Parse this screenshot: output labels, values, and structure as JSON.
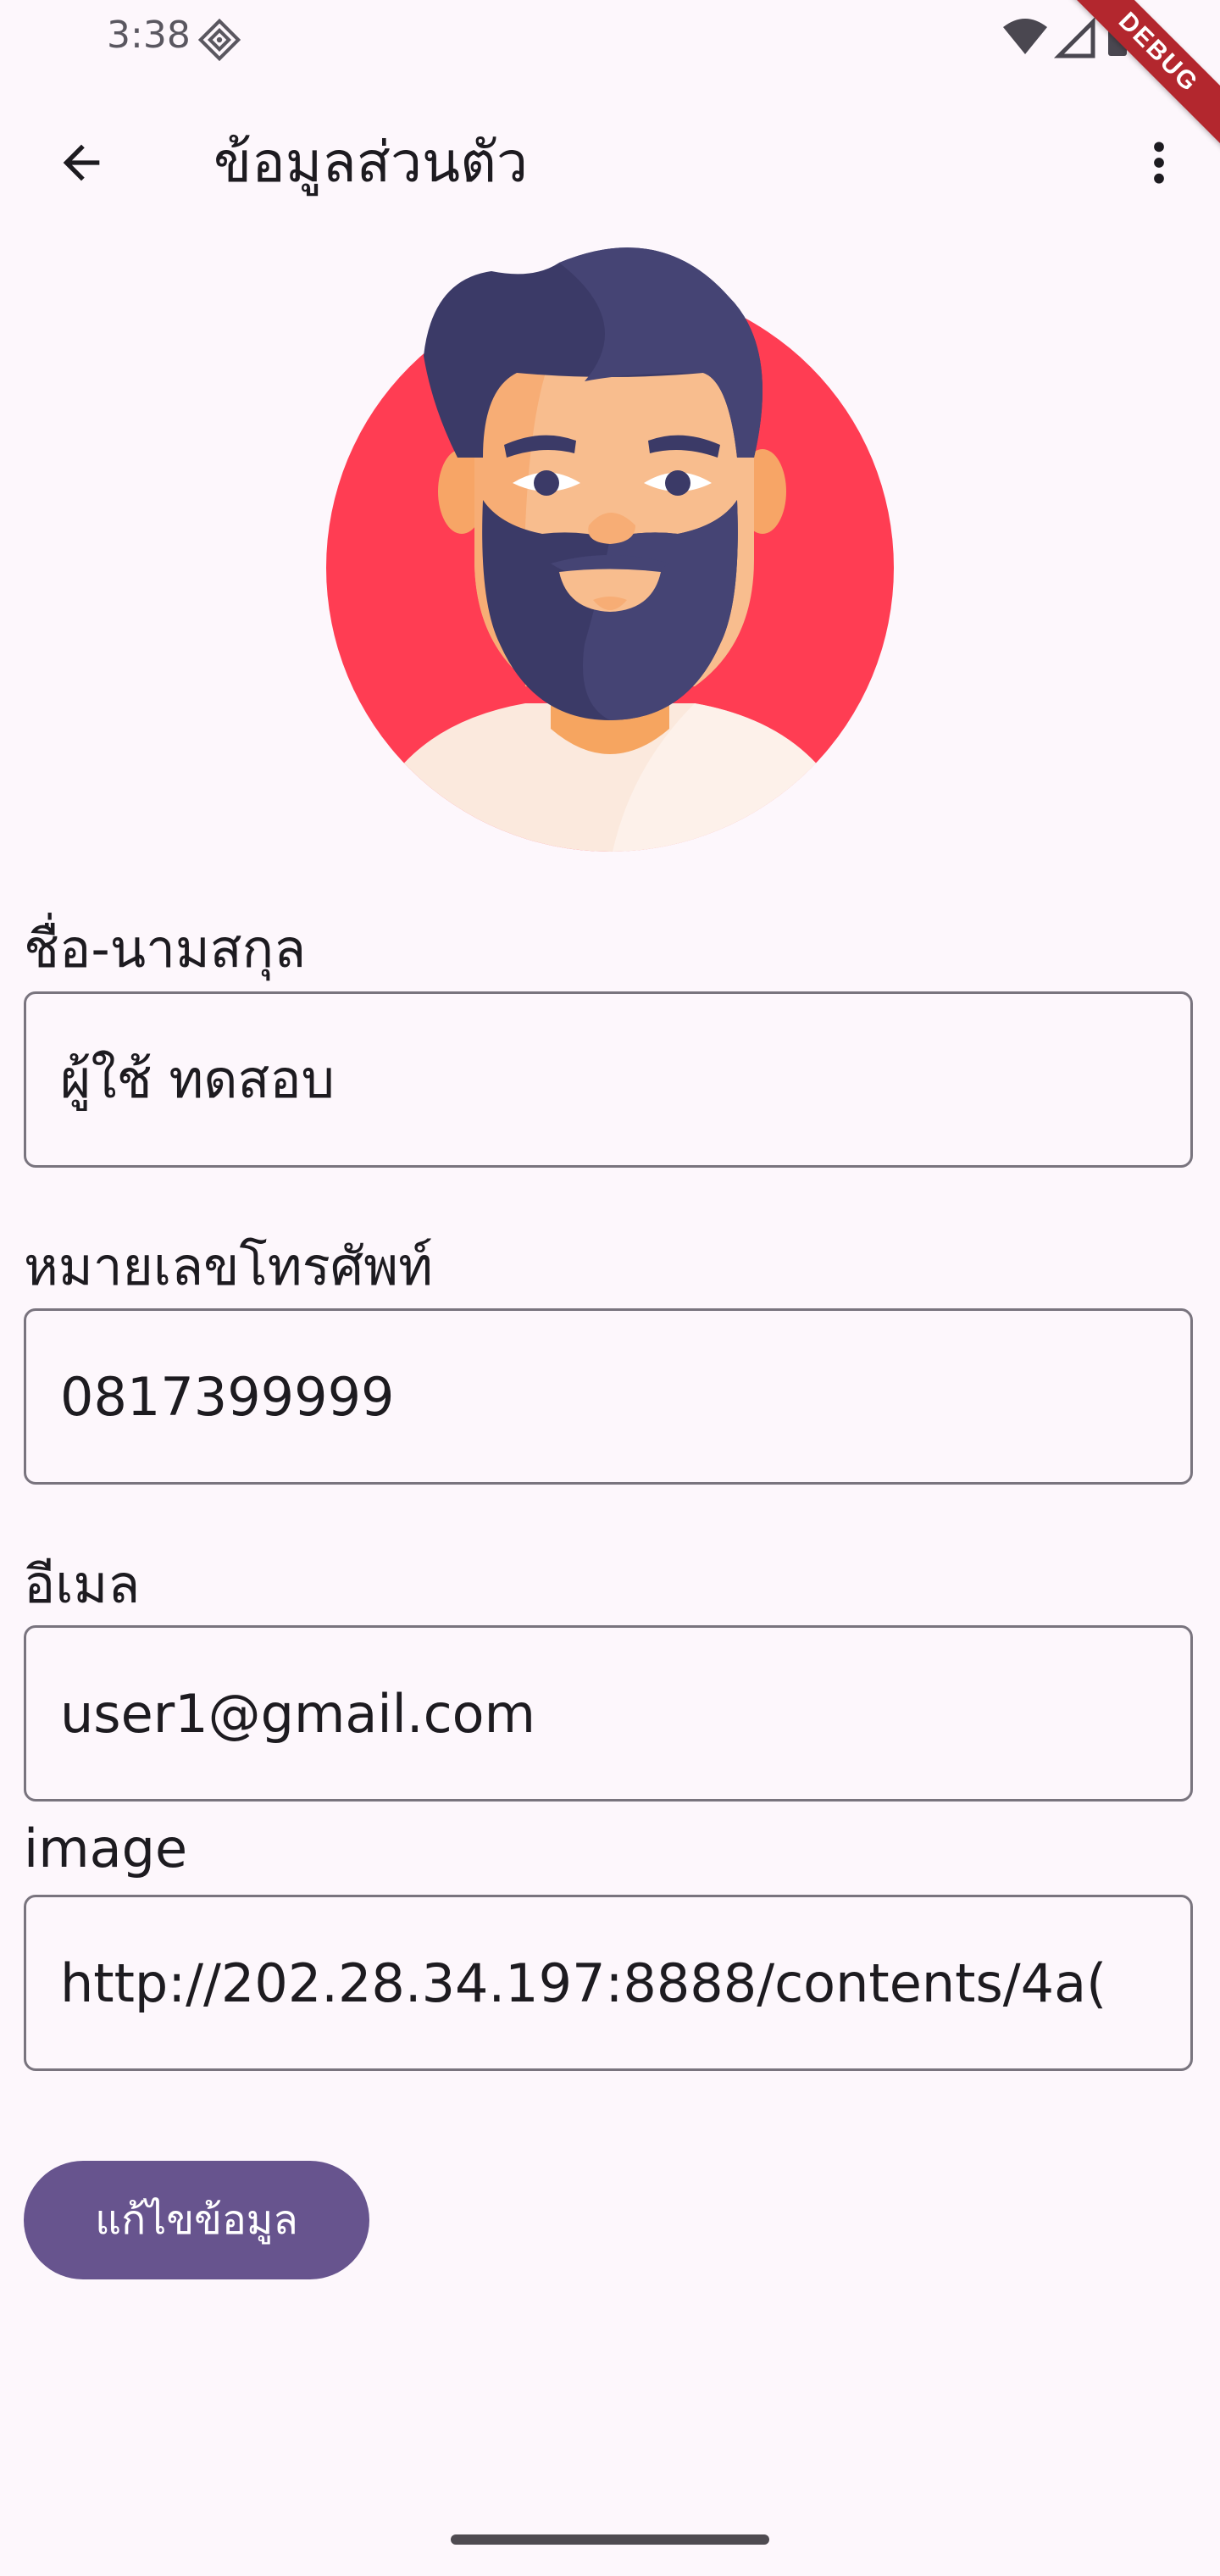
{
  "status_bar": {
    "time": "3:38",
    "app_icon": "notification-app-icon",
    "icons": [
      "wifi-icon",
      "cellular-signal-icon",
      "battery-icon"
    ],
    "debug_banner": "DEBUG"
  },
  "app_bar": {
    "back_icon": "arrow-back-icon",
    "title": "ข้อมูลส่วนตัว",
    "menu_icon": "more-vert-icon"
  },
  "avatar": {
    "description_icon": "bearded-man-avatar",
    "background_color": "#ff3d53"
  },
  "form": {
    "name": {
      "label": "ชื่อ-นามสกุล",
      "value": "ผู้ใช้ ทดสอบ"
    },
    "phone": {
      "label": "หมายเลขโทรศัพท์",
      "value": "0817399999"
    },
    "email": {
      "label": "อีเมล",
      "value": "user1@gmail.com"
    },
    "image": {
      "label": "image",
      "value": "http://202.28.34.197:8888/contents/4a("
    }
  },
  "actions": {
    "edit_label": "แก้ไขข้อมูล",
    "edit_color": "#67548e"
  }
}
